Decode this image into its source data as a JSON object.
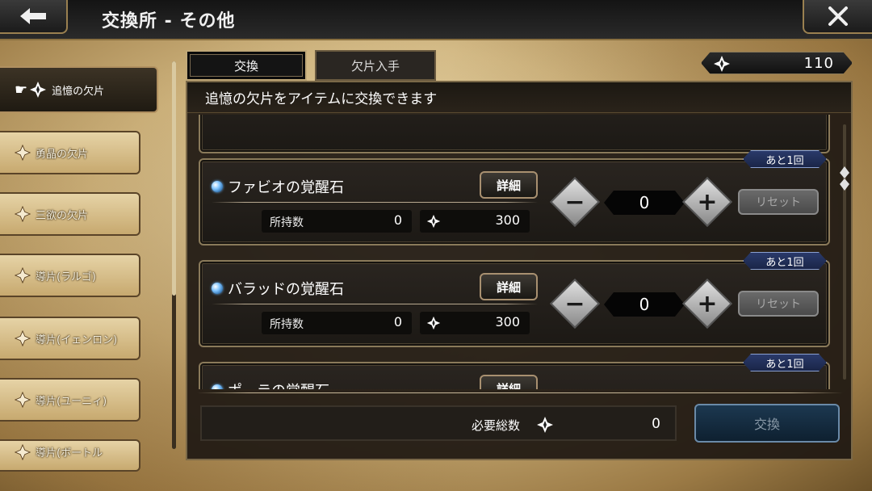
{
  "header": {
    "title": "交換所 - その他",
    "back_icon": "arrow-left-icon",
    "close_icon": "close-icon"
  },
  "sidebar": {
    "items": [
      {
        "label": "追憶の欠片",
        "active": true
      },
      {
        "label": "勇晶の欠片",
        "active": false
      },
      {
        "label": "三欲の欠片",
        "active": false
      },
      {
        "label": "導片(ラルゴ)",
        "active": false
      },
      {
        "label": "導片(イェンロン)",
        "active": false
      },
      {
        "label": "導片(ユーニィ)",
        "active": false
      },
      {
        "label": "導片(ボートル",
        "active": false
      }
    ]
  },
  "tabs": [
    {
      "label": "交換",
      "selected": true
    },
    {
      "label": "欠片入手",
      "selected": false
    }
  ],
  "currency": {
    "value": "110",
    "icon": "sparkle-gem-icon"
  },
  "description": "追憶の欠片をアイテムに交換できます",
  "items": [
    {
      "name": "ファビオの覚醒石",
      "detail_label": "詳細",
      "owned_label": "所持数",
      "owned": "0",
      "cost": "300",
      "quantity": "0",
      "reset_label": "リセット",
      "remaining": "あと1回"
    },
    {
      "name": "バラッドの覚醒石",
      "detail_label": "詳細",
      "owned_label": "所持数",
      "owned": "0",
      "cost": "300",
      "quantity": "0",
      "reset_label": "リセット",
      "remaining": "あと1回"
    },
    {
      "name": "ポ…ラの覚醒石",
      "detail_label": "詳細",
      "remaining": "あと1回"
    }
  ],
  "footer": {
    "total_label": "必要総数",
    "total_value": "0",
    "exchange_label": "交換"
  },
  "colors": {
    "panel": "#1e1812",
    "accent_gold": "#b09060",
    "exchange_button": "#1c3850",
    "badge_blue": "#2a3a6a"
  }
}
